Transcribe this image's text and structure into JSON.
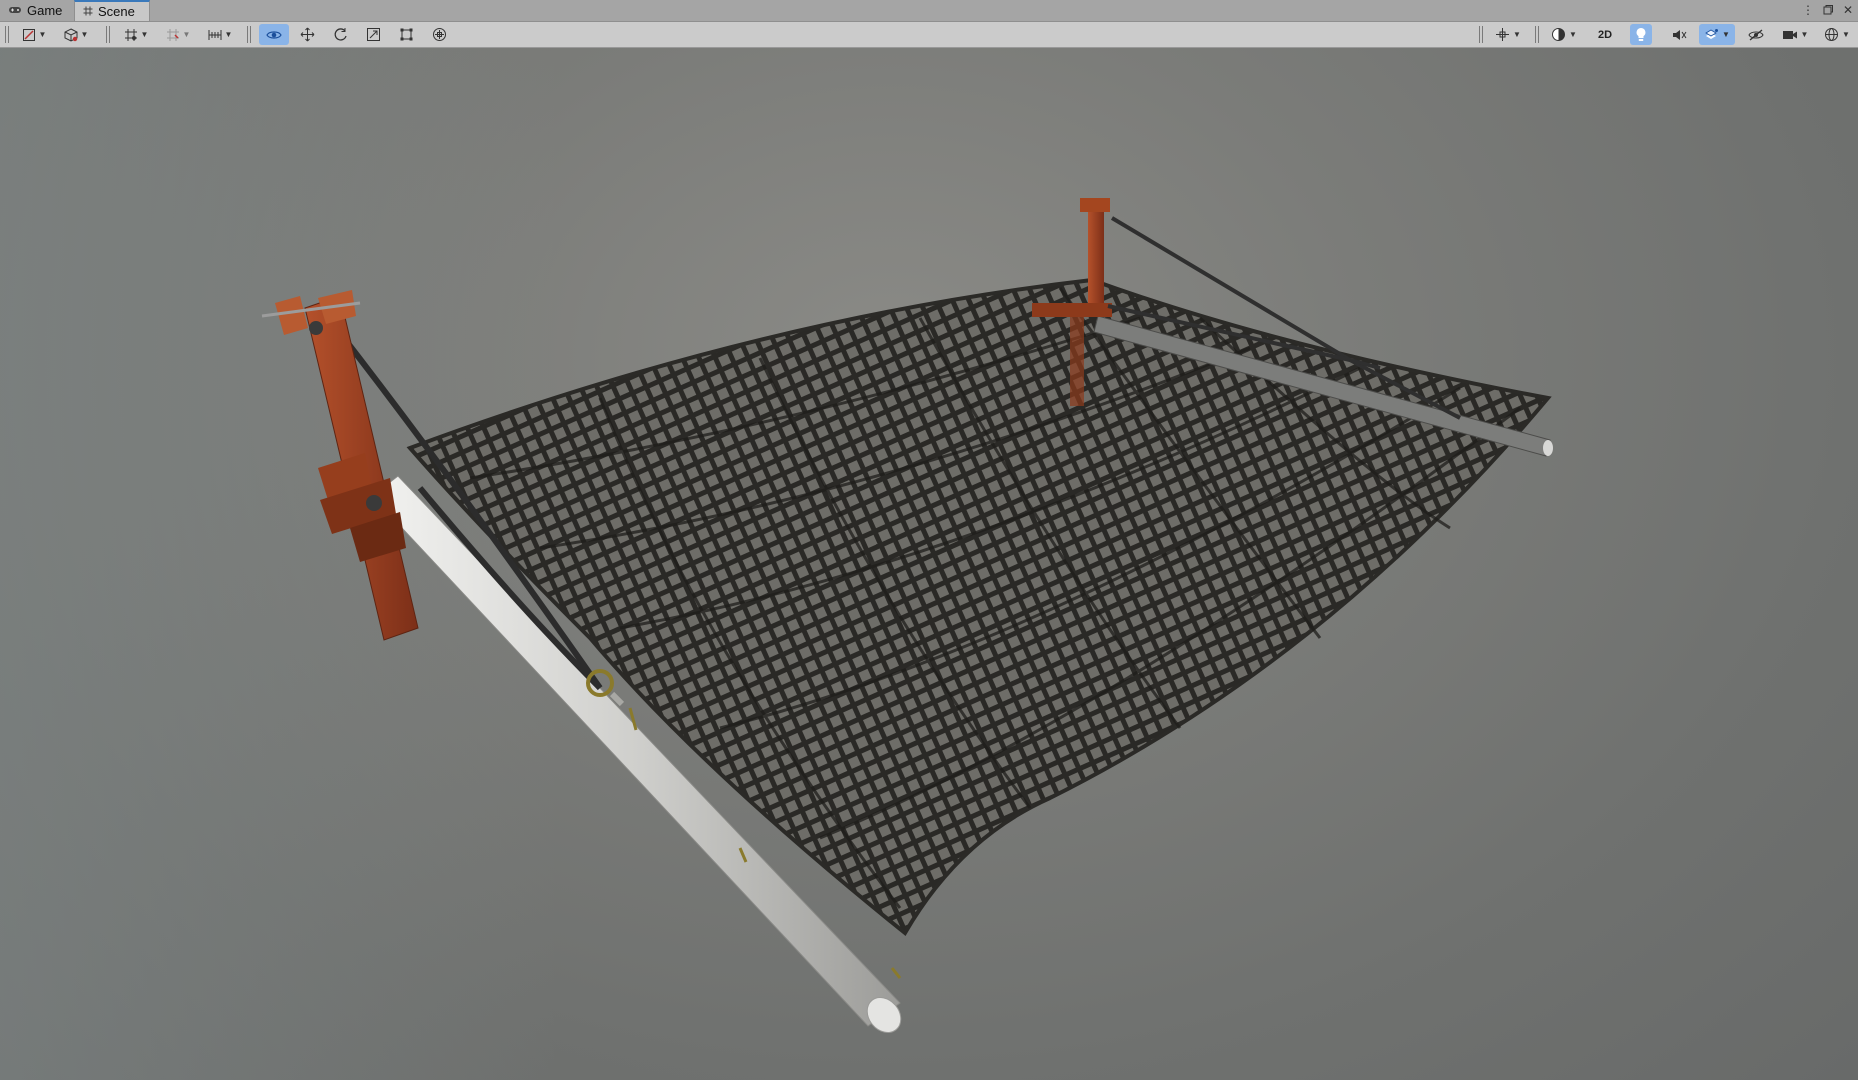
{
  "tabs": {
    "game": {
      "label": "Game",
      "icon": "gamepad-icon"
    },
    "scene": {
      "label": "Scene",
      "icon": "hash-icon"
    }
  },
  "window_controls": [
    "kebab-menu-icon",
    "maximize-icon",
    "close-icon"
  ],
  "toolbar": {
    "left_tools": [
      "draw-mode-icon",
      "render-mode-icon",
      "grid-snap-icon",
      "increment-snap-icon",
      "align-icon",
      "view-tool-icon",
      "move-tool-icon",
      "rotate-tool-icon",
      "scale-tool-icon",
      "rect-tool-icon",
      "transform-tool-icon"
    ],
    "view_tool_active": true,
    "right_tools": [
      "pivot-icon",
      "shading-icon",
      "lighting-icon",
      "audio-icon",
      "effects-icon",
      "visibility-icon",
      "camera-icon",
      "gizmos-icon"
    ],
    "mode_2d_label": "2D",
    "lighting_active": true,
    "effects_active": true
  },
  "viewport": {
    "content": "hammock-net-3d-model",
    "colors": {
      "background": "#7b7c79",
      "bracket": "#9a3f22",
      "net": "#2b2a27",
      "pipe": "#d8d8d6",
      "rope": "#2f2f2f",
      "accent": "#8ab4e8"
    }
  }
}
